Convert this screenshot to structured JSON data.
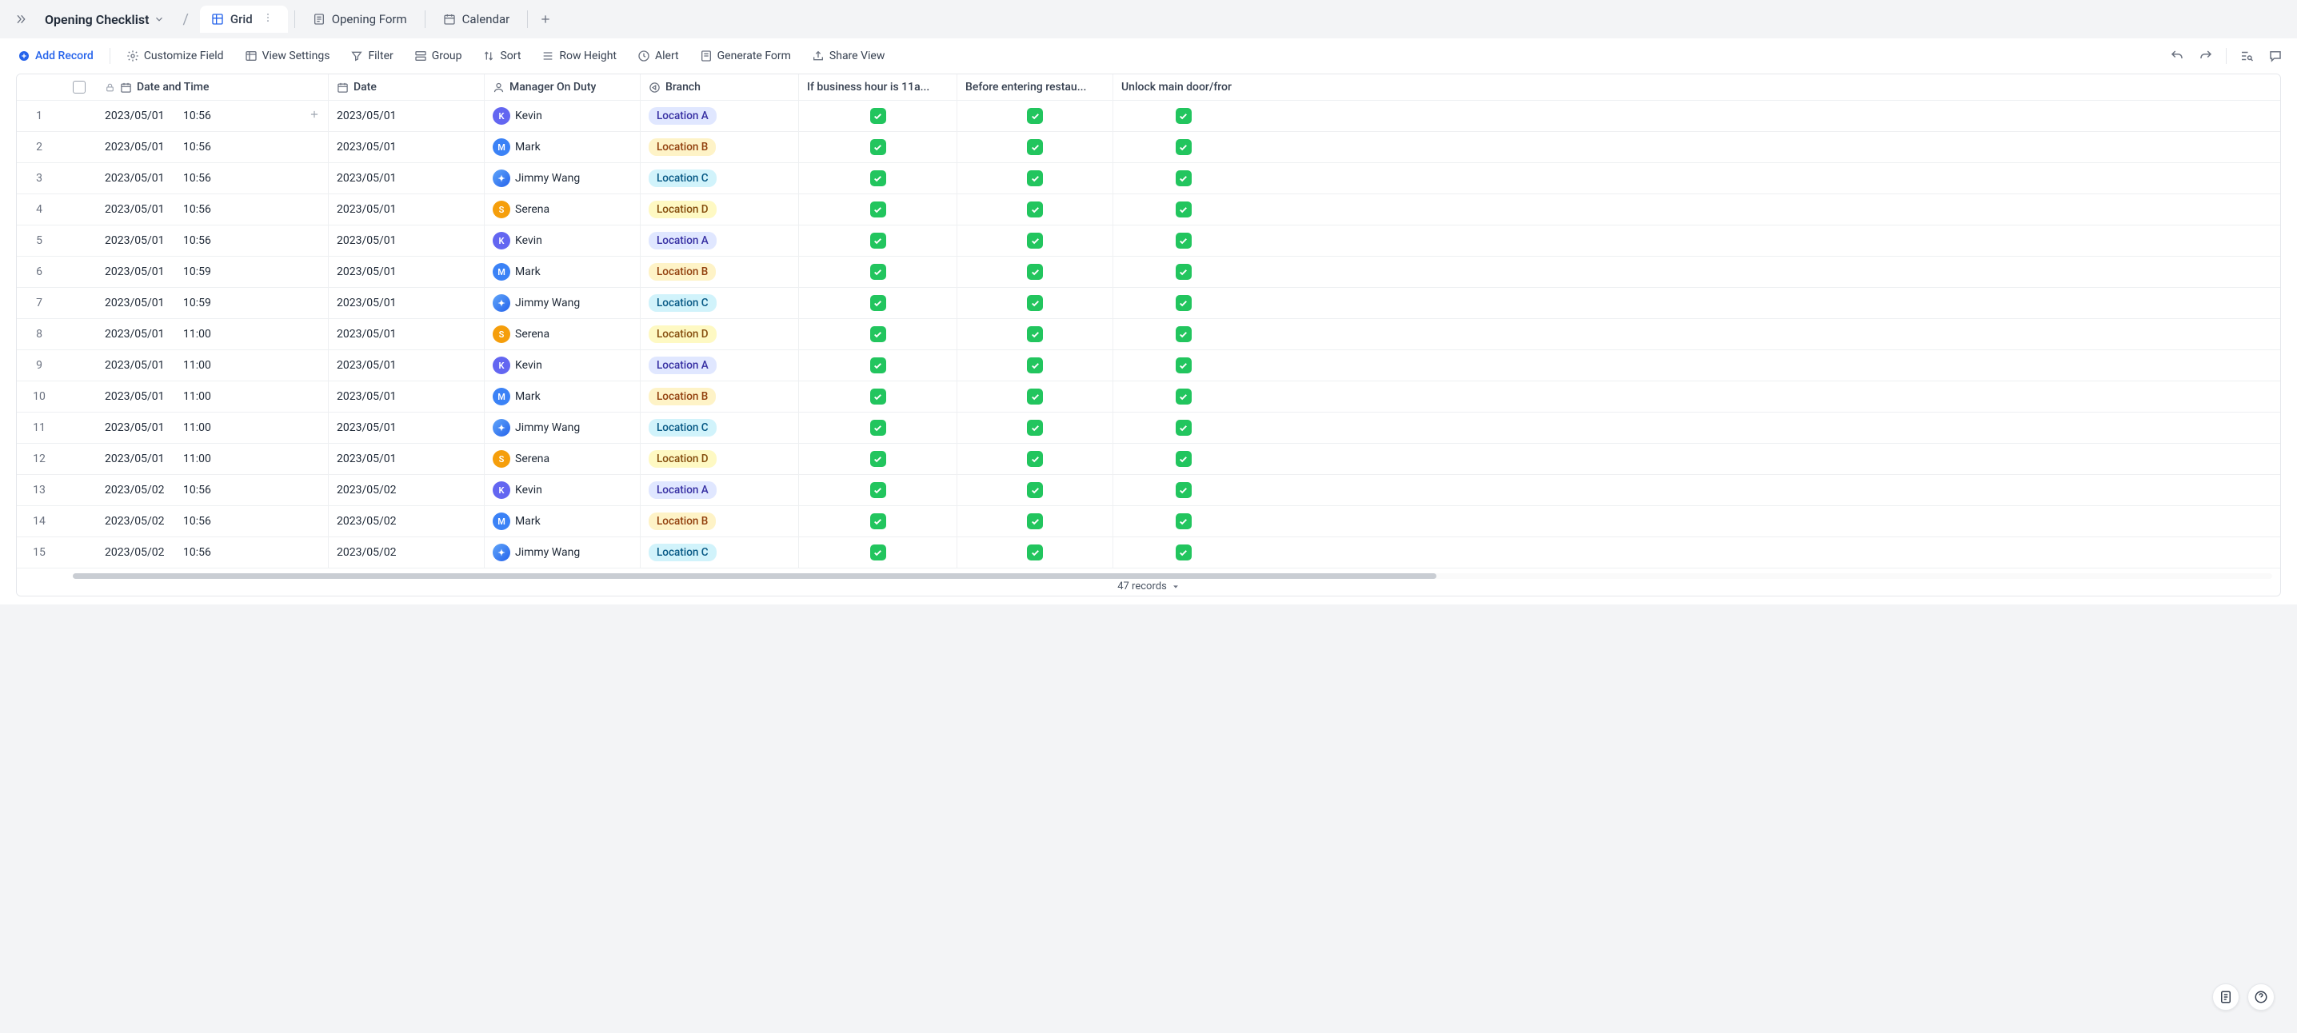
{
  "breadcrumb": {
    "title": "Opening Checklist"
  },
  "tabs": [
    {
      "id": "grid",
      "label": "Grid",
      "icon": "grid",
      "active": true
    },
    {
      "id": "form",
      "label": "Opening Form",
      "icon": "form",
      "active": false
    },
    {
      "id": "calendar",
      "label": "Calendar",
      "icon": "calendar",
      "active": false
    }
  ],
  "toolbar": {
    "add_record": "Add Record",
    "customize_field": "Customize Field",
    "view_settings": "View Settings",
    "filter": "Filter",
    "group": "Group",
    "sort": "Sort",
    "row_height": "Row Height",
    "alert": "Alert",
    "generate_form": "Generate Form",
    "share_view": "Share View"
  },
  "columns": {
    "datetime": "Date and Time",
    "date": "Date",
    "manager": "Manager On Duty",
    "branch": "Branch",
    "check1": "If business hour is 11a...",
    "check2": "Before entering restau...",
    "check3": "Unlock main door/fror"
  },
  "rows": [
    {
      "n": "1",
      "date": "2023/05/01",
      "time": "10:56",
      "d2": "2023/05/01",
      "manager": "Kevin",
      "mk": "kevin",
      "mi": "K",
      "branch": "Location A",
      "bk": "locA",
      "c1": true,
      "c2": true,
      "c3": true,
      "hoverAdd": true
    },
    {
      "n": "2",
      "date": "2023/05/01",
      "time": "10:56",
      "d2": "2023/05/01",
      "manager": "Mark",
      "mk": "mark",
      "mi": "M",
      "branch": "Location B",
      "bk": "locB",
      "c1": true,
      "c2": true,
      "c3": true
    },
    {
      "n": "3",
      "date": "2023/05/01",
      "time": "10:56",
      "d2": "2023/05/01",
      "manager": "Jimmy Wang",
      "mk": "jimmy",
      "mi": "✦",
      "branch": "Location C",
      "bk": "locC",
      "c1": true,
      "c2": true,
      "c3": true
    },
    {
      "n": "4",
      "date": "2023/05/01",
      "time": "10:56",
      "d2": "2023/05/01",
      "manager": "Serena",
      "mk": "serena",
      "mi": "S",
      "branch": "Location D",
      "bk": "locD",
      "c1": true,
      "c2": true,
      "c3": true
    },
    {
      "n": "5",
      "date": "2023/05/01",
      "time": "10:56",
      "d2": "2023/05/01",
      "manager": "Kevin",
      "mk": "kevin",
      "mi": "K",
      "branch": "Location A",
      "bk": "locA",
      "c1": true,
      "c2": true,
      "c3": true
    },
    {
      "n": "6",
      "date": "2023/05/01",
      "time": "10:59",
      "d2": "2023/05/01",
      "manager": "Mark",
      "mk": "mark",
      "mi": "M",
      "branch": "Location B",
      "bk": "locB",
      "c1": true,
      "c2": true,
      "c3": true
    },
    {
      "n": "7",
      "date": "2023/05/01",
      "time": "10:59",
      "d2": "2023/05/01",
      "manager": "Jimmy Wang",
      "mk": "jimmy",
      "mi": "✦",
      "branch": "Location C",
      "bk": "locC",
      "c1": true,
      "c2": true,
      "c3": true
    },
    {
      "n": "8",
      "date": "2023/05/01",
      "time": "11:00",
      "d2": "2023/05/01",
      "manager": "Serena",
      "mk": "serena",
      "mi": "S",
      "branch": "Location D",
      "bk": "locD",
      "c1": true,
      "c2": true,
      "c3": true
    },
    {
      "n": "9",
      "date": "2023/05/01",
      "time": "11:00",
      "d2": "2023/05/01",
      "manager": "Kevin",
      "mk": "kevin",
      "mi": "K",
      "branch": "Location A",
      "bk": "locA",
      "c1": true,
      "c2": true,
      "c3": true
    },
    {
      "n": "10",
      "date": "2023/05/01",
      "time": "11:00",
      "d2": "2023/05/01",
      "manager": "Mark",
      "mk": "mark",
      "mi": "M",
      "branch": "Location B",
      "bk": "locB",
      "c1": true,
      "c2": true,
      "c3": true
    },
    {
      "n": "11",
      "date": "2023/05/01",
      "time": "11:00",
      "d2": "2023/05/01",
      "manager": "Jimmy Wang",
      "mk": "jimmy",
      "mi": "✦",
      "branch": "Location C",
      "bk": "locC",
      "c1": true,
      "c2": true,
      "c3": true
    },
    {
      "n": "12",
      "date": "2023/05/01",
      "time": "11:00",
      "d2": "2023/05/01",
      "manager": "Serena",
      "mk": "serena",
      "mi": "S",
      "branch": "Location D",
      "bk": "locD",
      "c1": true,
      "c2": true,
      "c3": true
    },
    {
      "n": "13",
      "date": "2023/05/02",
      "time": "10:56",
      "d2": "2023/05/02",
      "manager": "Kevin",
      "mk": "kevin",
      "mi": "K",
      "branch": "Location A",
      "bk": "locA",
      "c1": true,
      "c2": true,
      "c3": true
    },
    {
      "n": "14",
      "date": "2023/05/02",
      "time": "10:56",
      "d2": "2023/05/02",
      "manager": "Mark",
      "mk": "mark",
      "mi": "M",
      "branch": "Location B",
      "bk": "locB",
      "c1": true,
      "c2": true,
      "c3": true
    },
    {
      "n": "15",
      "date": "2023/05/02",
      "time": "10:56",
      "d2": "2023/05/02",
      "manager": "Jimmy Wang",
      "mk": "jimmy",
      "mi": "✦",
      "branch": "Location C",
      "bk": "locC",
      "c1": true,
      "c2": true,
      "c3": true
    }
  ],
  "footer": {
    "count_label": "47 records"
  }
}
